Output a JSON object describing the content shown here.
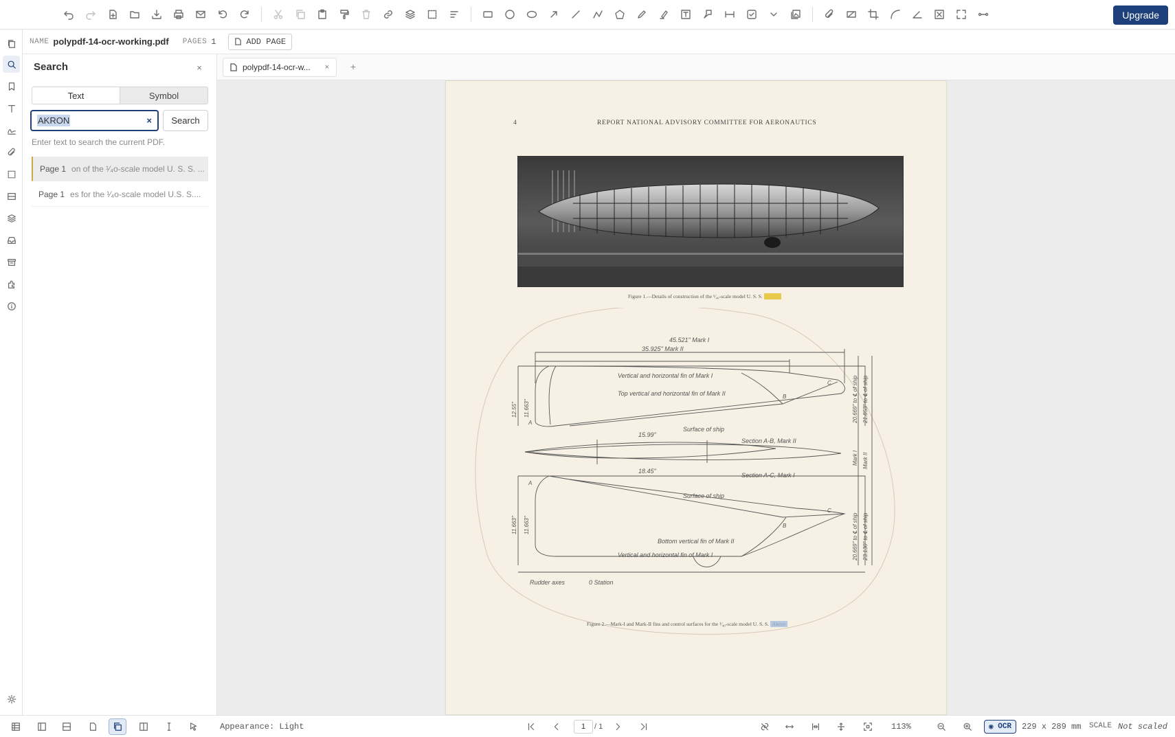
{
  "toolbar": {
    "upgrade_label": "Upgrade"
  },
  "infobar": {
    "name_label": "NAME",
    "doc_name": "polypdf-14-ocr-working.pdf",
    "pages_label": "PAGES",
    "pages_count": "1",
    "add_page_label": "ADD PAGE"
  },
  "search": {
    "title": "Search",
    "close": "×",
    "tab_text": "Text",
    "tab_symbol": "Symbol",
    "query": "AKRON",
    "clear": "×",
    "button": "Search",
    "hint": "Enter text to search the current PDF.",
    "results": [
      {
        "page": "Page 1",
        "snippet": "on of the ¹⁄₄o-scale model U. S. S. ..."
      },
      {
        "page": "Page 1",
        "snippet": "es for the ¹⁄₄o-scale model U.S. S...."
      }
    ]
  },
  "tabs": [
    {
      "label": "polypdf-14-ocr-w...",
      "close": "×"
    }
  ],
  "tab_add": "+",
  "page": {
    "number": "4",
    "header": "REPORT NATIONAL ADVISORY COMMITTEE FOR AERONAUTICS",
    "figure1_caption": "Figure 1.—Details of construction of the ¹⁄₄₀-scale model U. S. S.",
    "figure1_highlight": "Akron",
    "figure2_caption": "Figure 2.—Mark-I and Mark-II fins and control surfaces for the ¹⁄₄₀-scale model U. S. S.",
    "figure2_highlight": "Akron",
    "drawing_labels": {
      "dim_mark1": "45.521\" Mark I",
      "dim_mark2": "35.925\" Mark II",
      "fin_mark1": "Vertical and horizontal fin of Mark I",
      "fin_mark2": "Top vertical and horizontal fin of Mark II",
      "surface1": "Surface of ship",
      "section_ab": "Section A-B, Mark II",
      "dim_1599": "15.99\"",
      "dim_1845": "18.45\"",
      "section_ac": "Section A-C, Mark I",
      "surface2": "Surface of ship",
      "bottom_fin": "Bottom vertical fin of Mark II",
      "fin_mark1b": "Vertical and horizontal fin of Mark I",
      "rudder": "Rudder axes",
      "station": "0 Station",
      "left_dim1": "12.55\"",
      "left_dim2": "11.663\"",
      "left_dim3": "11.663\"",
      "left_dim4": "11.663\"",
      "right_dim1": "20.669\" to ℄ of ship",
      "right_dim2": "21.853\" to ℄ of ship",
      "right_dim3": "20.669\" to ℄ of ship",
      "right_dim4": "23.130\" to ℄ of ship",
      "mark_i": "Mark I",
      "mark_ii": "Mark II",
      "pt_a": "A",
      "pt_b": "B",
      "pt_c": "C"
    }
  },
  "status": {
    "appearance": "Appearance: Light",
    "page_current": "1",
    "page_total": "/ 1",
    "zoom": "113%",
    "ocr": "OCR",
    "dims": "229 x 289 mm",
    "scale_label": "SCALE",
    "scale_value": "Not scaled"
  },
  "colors": {
    "accent": "#1d3f7a",
    "highlight_yellow": "#e8c94a",
    "page_bg": "#f6f1e4"
  }
}
